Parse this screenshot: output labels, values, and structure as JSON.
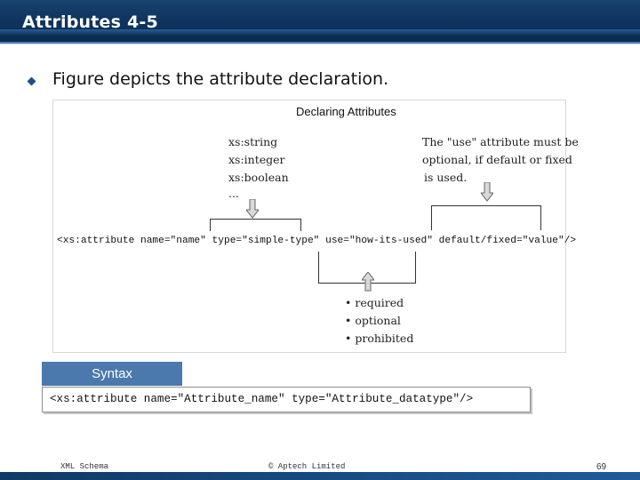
{
  "slide": {
    "title": "Attributes 4-5",
    "bullet": "Figure depicts the attribute declaration.",
    "page_number": "69"
  },
  "figure": {
    "title": "Declaring Attributes",
    "types": [
      "xs:string",
      "xs:integer",
      "xs:boolean",
      "..."
    ],
    "use_note": [
      "The \"use\" attribute must be",
      "optional, if default or fixed",
      "is used."
    ],
    "declaration": "<xs:attribute name=\"name\" type=\"simple-type\" use=\"how-its-used\" default/fixed=\"value\"/>",
    "use_values": [
      "• required",
      "• optional",
      "• prohibited"
    ]
  },
  "syntax": {
    "label": "Syntax",
    "code": "<xs:attribute name=\"Attribute_name\" type=\"Attribute_datatype\"/>"
  },
  "footer": {
    "left": "XML Schema",
    "center": "© Aptech Limited"
  },
  "colors": {
    "title_bar": "#0f3560",
    "syntax_tab": "#4b79ad",
    "bullet": "#1d4f86"
  }
}
